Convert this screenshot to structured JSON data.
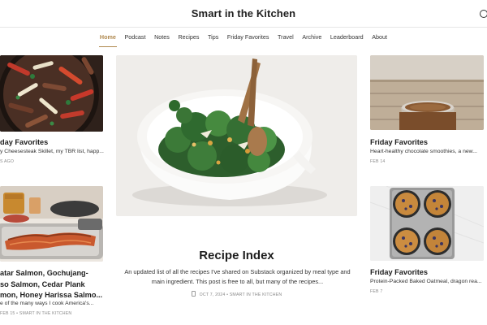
{
  "site": {
    "title": "Smart in the Kitchen"
  },
  "nav": {
    "items": [
      "Home",
      "Podcast",
      "Notes",
      "Recipes",
      "Tips",
      "Friday Favorites",
      "Travel",
      "Archive",
      "Leaderboard",
      "About"
    ],
    "active": "Home"
  },
  "left_top": {
    "title": "day Favorites",
    "subtitle": "y Cheesesteak Skillet, my TBR list, happ...",
    "meta": "S AGO"
  },
  "left_bottom": {
    "title_lines": [
      "atar Salmon, Gochujang-",
      "so Salmon, Cedar Plank",
      "mon, Honey Harissa Salmo..."
    ],
    "subtitle": "e of the many ways I cook America's...",
    "meta": "FEB 15 • SMART IN THE KITCHEN"
  },
  "center": {
    "title": "Recipe Index",
    "description": "An updated list of all the recipes I've shared on Substack organized by meal type and main ingredient. This post is free to all, but many of the recipes...",
    "meta": "OCT 7, 2024 • SMART IN THE KITCHEN"
  },
  "right_top": {
    "title": "Friday Favorites",
    "subtitle": "Heart-healthy chocolate smoothies, a new...",
    "meta": "FEB 14"
  },
  "right_bottom": {
    "title": "Friday Favorites",
    "subtitle": "Protein-Packed Baked Oatmeal, dragon rea...",
    "meta": "FEB 7"
  },
  "colors": {
    "accent": "#b0894f",
    "text": "#1e1e1e",
    "muted": "#8a8a8a"
  }
}
